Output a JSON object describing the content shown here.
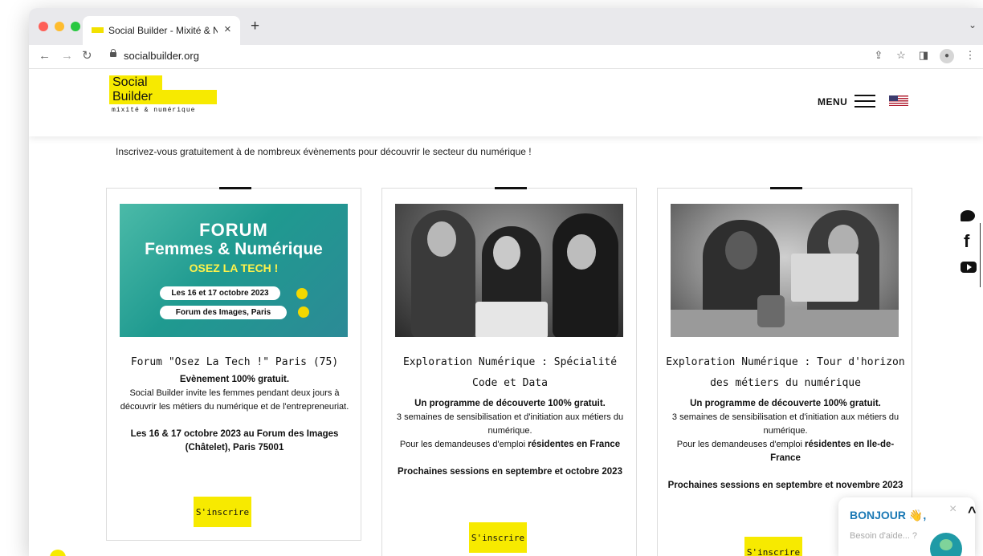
{
  "browser": {
    "tab_title": "Social Builder - Mixité & Numérique",
    "tab_close": "×",
    "new_tab": "+",
    "url": "socialbuilder.org"
  },
  "header": {
    "logo_line1": "Social",
    "logo_line2": "Builder",
    "logo_tagline": "mixité & numérique",
    "menu_label": "MENU"
  },
  "intro": "Inscrivez-vous gratuitement à de nombreux évènements pour découvrir le secteur du numérique !",
  "cards": [
    {
      "image": {
        "line1": "FORUM",
        "line2": "Femmes & Numérique",
        "line3": "OSEZ LA TECH !",
        "pill1": "Les 16 et 17 octobre 2023",
        "pill2": "Forum des Images, Paris"
      },
      "title": "Forum \"Osez La Tech !\" Paris (75)",
      "bold1": "Evènement 100% gratuit.",
      "text1": "Social Builder invite les femmes pendant deux jours à découvrir les métiers du numérique et de l'entrepreneuriat.",
      "bold2": "Les 16 & 17 octobre 2023 au Forum des Images (Châtelet), Paris 75001",
      "button": "S'inscrire"
    },
    {
      "title": "Exploration Numérique : Spécialité Code et Data",
      "bold1": "Un programme de découverte 100% gratuit.",
      "text1": "3 semaines de sensibilisation et d'initiation aux métiers du numérique.",
      "text2": "Pour les demandeuses d'emploi ",
      "text2_bold": "résidentes en France",
      "bold2": "Prochaines sessions en septembre et octobre 2023",
      "button": "S'inscrire"
    },
    {
      "title": "Exploration Numérique : Tour d'horizon des métiers du numérique",
      "bold1": "Un programme de découverte 100% gratuit.",
      "text1": "3 semaines de sensibilisation et d'initiation aux métiers du numérique.",
      "text2": "Pour les demandeuses d'emploi ",
      "text2_bold": "résidentes en Ile-de-France",
      "bold2": "Prochaines sessions en septembre et novembre 2023",
      "button": "S'inscrire"
    }
  ],
  "social": {
    "facebook_glyph": "f"
  },
  "chat": {
    "title": "BONJOUR 👋,",
    "subtitle": "Besoin d'aide... ?",
    "close": "×"
  },
  "colors": {
    "brand_yellow": "#f7ea00",
    "chat_blue": "#1b79b5"
  }
}
